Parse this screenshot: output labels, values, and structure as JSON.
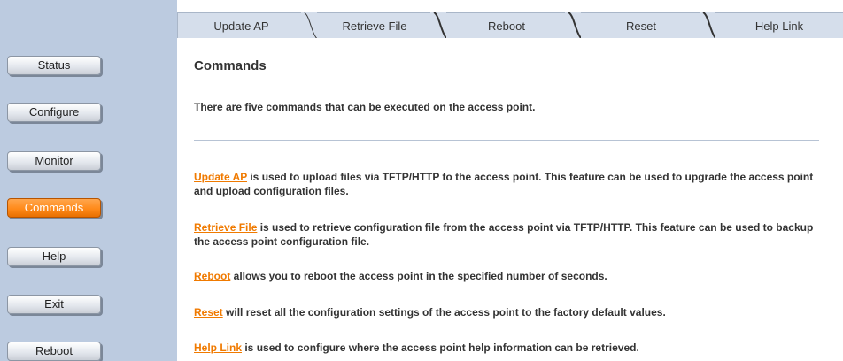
{
  "sidebar": {
    "items": [
      {
        "label": "Status",
        "active": false
      },
      {
        "label": "Configure",
        "active": false
      },
      {
        "label": "Monitor",
        "active": false
      },
      {
        "label": "Commands",
        "active": true
      },
      {
        "label": "Help",
        "active": false
      },
      {
        "label": "Exit",
        "active": false
      },
      {
        "label": "Reboot",
        "active": false
      }
    ]
  },
  "tabs": [
    {
      "label": "Update AP"
    },
    {
      "label": "Retrieve File"
    },
    {
      "label": "Reboot"
    },
    {
      "label": "Reset"
    },
    {
      "label": "Help Link"
    }
  ],
  "main": {
    "title": "Commands",
    "intro": "There are five commands that can be executed on the access point.",
    "descriptions": [
      {
        "link": "Update AP",
        "text": " is used to upload files via TFTP/HTTP to the access point. This feature can be used to upgrade the access point and upload configuration files."
      },
      {
        "link": "Retrieve File",
        "text": " is used to retrieve configuration file from the access point via TFTP/HTTP. This feature can be used to backup the access point configuration file."
      },
      {
        "link": "Reboot",
        "text": " allows you to reboot the access point in the specified number of seconds."
      },
      {
        "link": "Reset",
        "text": " will reset all the configuration settings of the access point to the factory default values."
      },
      {
        "link": "Help Link",
        "text": " is used to configure where the access point help information can be retrieved."
      }
    ]
  },
  "colors": {
    "sidebar_bg": "#bccbe0",
    "tab_bg": "#d5deeb",
    "accent": "#f07a00",
    "text": "#333333"
  }
}
